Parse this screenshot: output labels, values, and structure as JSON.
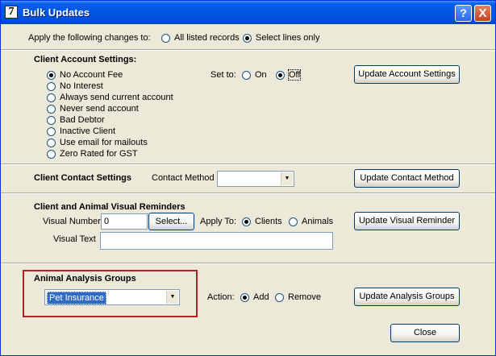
{
  "window": {
    "title": "Bulk Updates",
    "app_icon_glyph": "7",
    "help_glyph": "?",
    "close_glyph": "X"
  },
  "apply": {
    "label": "Apply the following changes to:",
    "options": [
      "All listed records",
      "Select lines only"
    ],
    "selected": "Select lines only"
  },
  "account": {
    "heading": "Client Account Settings:",
    "options": [
      "No Account Fee",
      "No Interest",
      "Always send current account",
      "Never send account",
      "Bad Debtor",
      "Inactive Client",
      "Use email for mailouts",
      "Zero Rated for GST"
    ],
    "selected": "No Account Fee",
    "set_to_label": "Set to:",
    "set_on": "On",
    "set_off": "Off",
    "set_selected": "Off",
    "button": "Update Account Settings"
  },
  "contact": {
    "heading": "Client Contact Settings",
    "method_label": "Contact Method",
    "method_value": "",
    "button": "Update Contact Method"
  },
  "reminders": {
    "heading": "Client and Animal Visual Reminders",
    "number_label": "Visual Number",
    "number_value": "0",
    "select_button": "Select...",
    "apply_to_label": "Apply To:",
    "apply_clients": "Clients",
    "apply_animals": "Animals",
    "apply_selected": "Clients",
    "text_label": "Visual Text",
    "text_value": "",
    "button": "Update Visual Reminder"
  },
  "analysis": {
    "heading": "Animal Analysis Groups",
    "group_value": "Pet Insurance",
    "action_label": "Action:",
    "action_add": "Add",
    "action_remove": "Remove",
    "action_selected": "Add",
    "button": "Update Analysis Groups"
  },
  "close_button": "Close",
  "colors": {
    "titlebar": "#0058e6",
    "dialog_bg": "#ece9d8",
    "highlight_border": "#b22222",
    "selection": "#316ac5"
  }
}
